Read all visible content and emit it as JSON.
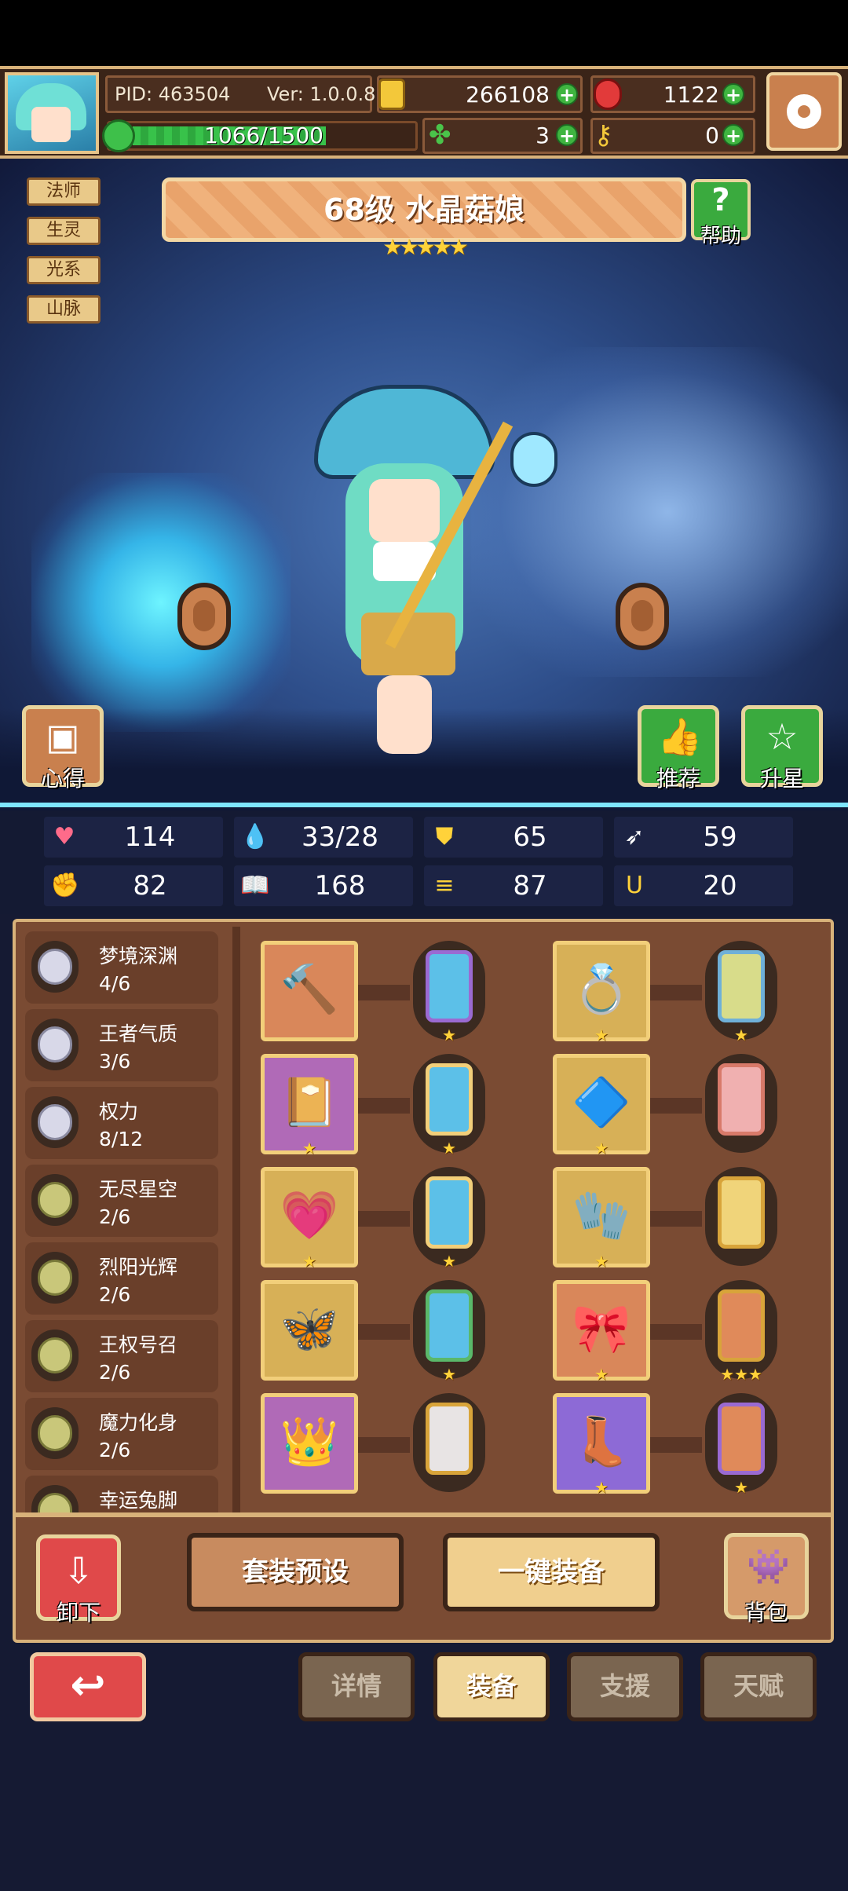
{
  "header": {
    "pid": "PID: 463504",
    "version": "Ver: 1.0.0.8",
    "exp": "1066/1500",
    "exp_fraction": 0.71,
    "gold": "266108",
    "gems": "1122",
    "clover": "3",
    "keys": "0"
  },
  "character": {
    "title": "68级 水晶菇娘",
    "stars": "★★★★★",
    "tags": [
      "法师",
      "生灵",
      "光系",
      "山脉"
    ]
  },
  "buttons": {
    "help": "帮助",
    "insight": "心得",
    "recommend": "推荐",
    "star_up": "升星",
    "unequip": "卸下",
    "preset": "套装预设",
    "equip_all": "一键装备",
    "bag": "背包"
  },
  "stats": [
    {
      "icon": "heart-icon",
      "glyph": "♥",
      "color": "#ff6b8a",
      "value": "114"
    },
    {
      "icon": "droplet-icon",
      "glyph": "💧",
      "color": "#7ec8ff",
      "value": "33/28"
    },
    {
      "icon": "shield-icon",
      "glyph": "⛊",
      "color": "#ffd23a",
      "value": "65"
    },
    {
      "icon": "wing-icon",
      "glyph": "➶",
      "color": "#ffffff",
      "value": "59"
    },
    {
      "icon": "fist-icon",
      "glyph": "✊",
      "color": "#f0a080",
      "value": "82"
    },
    {
      "icon": "book-icon",
      "glyph": "📖",
      "color": "#ffffff",
      "value": "168"
    },
    {
      "icon": "scroll-icon",
      "glyph": "≡",
      "color": "#ffd23a",
      "value": "87"
    },
    {
      "icon": "horseshoe-icon",
      "glyph": "Ս",
      "color": "#ffd23a",
      "value": "20"
    }
  ],
  "sets": [
    {
      "name": "梦境深渊",
      "progress": "4/6",
      "tone": "s"
    },
    {
      "name": "王者气质",
      "progress": "3/6",
      "tone": "s"
    },
    {
      "name": "权力",
      "progress": "8/12",
      "tone": "s"
    },
    {
      "name": "无尽星空",
      "progress": "2/6",
      "tone": "g"
    },
    {
      "name": "烈阳光辉",
      "progress": "2/6",
      "tone": "g"
    },
    {
      "name": "王权号召",
      "progress": "2/6",
      "tone": "g"
    },
    {
      "name": "魔力化身",
      "progress": "2/6",
      "tone": "g"
    },
    {
      "name": "幸运兔脚",
      "progress": "",
      "tone": "g"
    }
  ],
  "equipment": [
    {
      "item": "staff-icon",
      "glyph": "🔨",
      "bg": "orange",
      "item_stars": "",
      "gem": "blue",
      "gem_stars": "★"
    },
    {
      "item": "ring-icon",
      "glyph": "💍",
      "bg": "gold",
      "item_stars": "★",
      "gem": "lime",
      "gem_stars": "★"
    },
    {
      "item": "spellbook-icon",
      "glyph": "📔",
      "bg": "purple",
      "item_stars": "★",
      "gem": "blue2",
      "gem_stars": "★"
    },
    {
      "item": "amulet-icon",
      "glyph": "🔷",
      "bg": "gold",
      "item_stars": "★",
      "gem": "pink",
      "gem_stars": ""
    },
    {
      "item": "heart-necklace-icon",
      "glyph": "💗",
      "bg": "gold",
      "item_stars": "★",
      "gem": "blue2",
      "gem_stars": "★"
    },
    {
      "item": "glove-icon",
      "glyph": "🧤",
      "bg": "gold",
      "item_stars": "★",
      "gem": "yel",
      "gem_stars": ""
    },
    {
      "item": "winged-charm-icon",
      "glyph": "🦋",
      "bg": "gold",
      "item_stars": "",
      "gem": "blue3",
      "gem_stars": "★"
    },
    {
      "item": "belt-icon",
      "glyph": "🎀",
      "bg": "orange",
      "item_stars": "★",
      "gem": "org",
      "gem_stars": "★★★"
    },
    {
      "item": "crown-icon",
      "glyph": "👑",
      "bg": "purple",
      "item_stars": "",
      "gem": "white",
      "gem_stars": ""
    },
    {
      "item": "boots-icon",
      "glyph": "👢",
      "bg": "violet",
      "item_stars": "★",
      "gem": "orange2",
      "gem_stars": "★"
    }
  ],
  "nav": {
    "tabs": [
      {
        "label": "详情",
        "active": false
      },
      {
        "label": "装备",
        "active": true
      },
      {
        "label": "支援",
        "active": false
      },
      {
        "label": "天赋",
        "active": false
      }
    ]
  }
}
